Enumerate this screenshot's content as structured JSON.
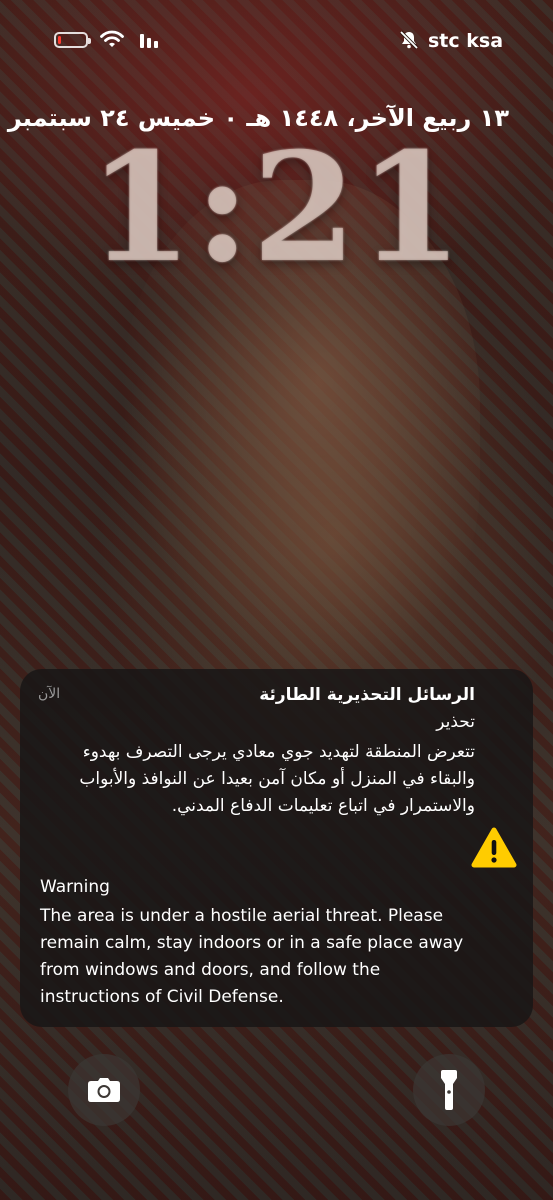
{
  "status_bar": {
    "carrier": "stc ksa",
    "battery_level": 0.1,
    "battery_color": "#ff3b30",
    "icons": [
      "battery-icon",
      "wifi-icon",
      "cellular-signal-icon",
      "bell-slash-icon"
    ]
  },
  "lock_screen": {
    "date": "١٣ ربيع الآخر، ١٤٤٨ هـ ٠ خميس ٢٤ سبتمبر",
    "time": "1:21"
  },
  "notification": {
    "app_title": "الرسائل التحذيرية الطارئة",
    "time": "الآن",
    "arabic_heading": "تحذير",
    "arabic_body": "تتعرض المنطقة لتهديد جوي معادي يرجى التصرف بهدوء والبقاء في المنزل أو مكان آمن بعيدا عن النوافذ والأبواب والاستمرار في اتباع تعليمات الدفاع المدني.",
    "english_heading": "Warning",
    "english_body": "The area is under a hostile aerial threat. Please remain calm, stay indoors or in a safe place away from windows and doors, and follow the instructions of Civil Defense.",
    "icon": "warning-icon",
    "icon_color": "#ffcc00"
  },
  "bottom_controls": {
    "left_icon": "camera-icon",
    "right_icon": "flashlight-icon"
  }
}
